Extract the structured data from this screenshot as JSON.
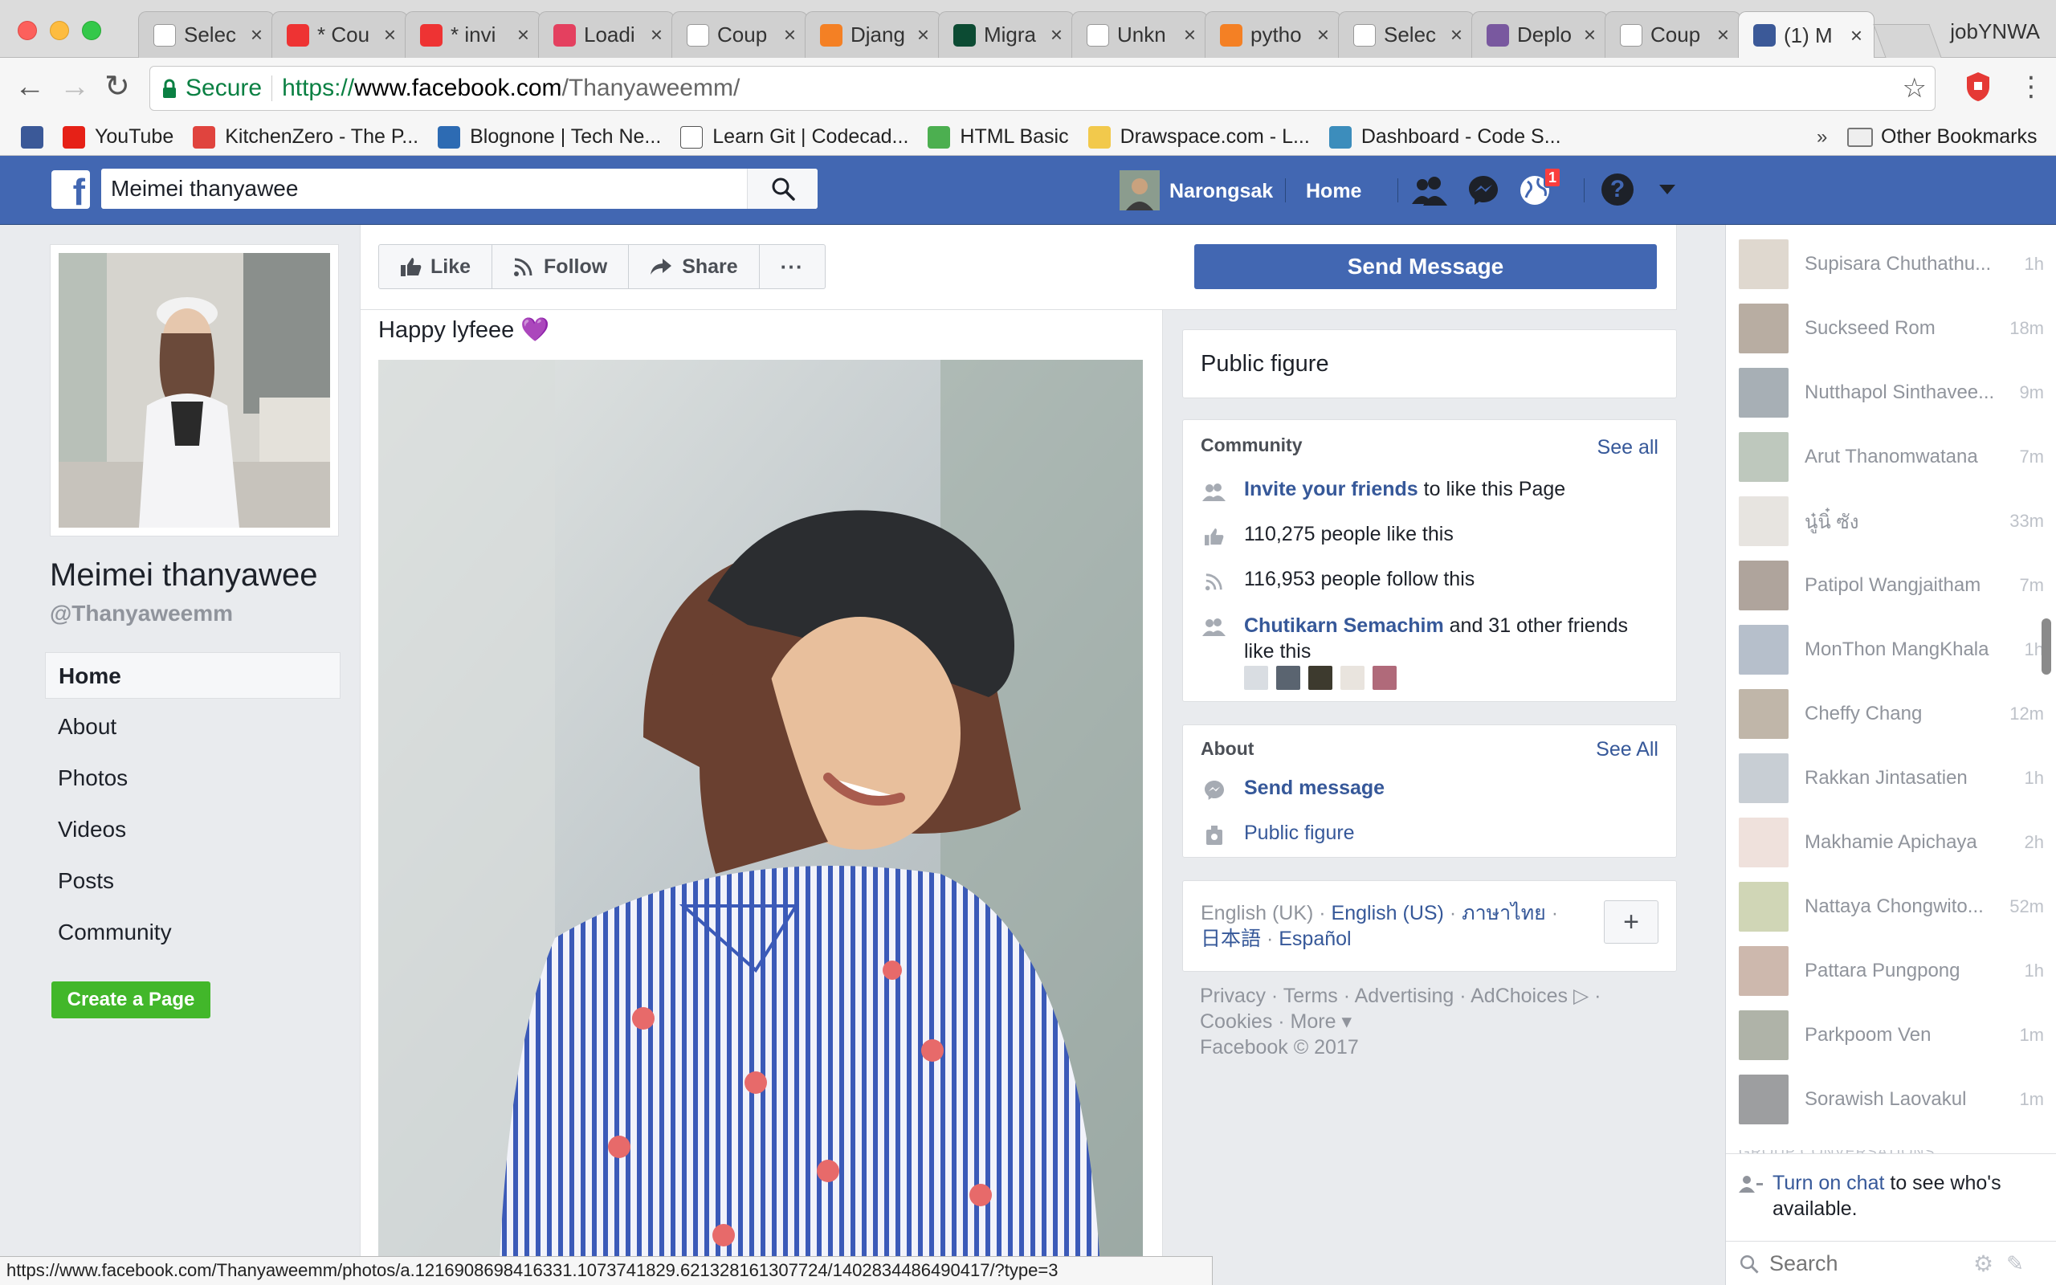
{
  "browser": {
    "profile": "jobYNWA",
    "tabs": [
      {
        "title": "Selec",
        "icon": "laravel",
        "color": "#fff"
      },
      {
        "title": "* Cou",
        "icon": "app-red",
        "color": "#e33"
      },
      {
        "title": "* invi",
        "icon": "app-red",
        "color": "#e33"
      },
      {
        "title": "Loadi",
        "icon": "invision",
        "color": "#e4405f"
      },
      {
        "title": "Coup",
        "icon": "laravel",
        "color": "#fff"
      },
      {
        "title": "Djang",
        "icon": "stackoverflow",
        "color": "#f48024"
      },
      {
        "title": "Migra",
        "icon": "django",
        "color": "#0c4b33"
      },
      {
        "title": "Unkn",
        "icon": "google",
        "color": "#fff"
      },
      {
        "title": "pytho",
        "icon": "stackoverflow",
        "color": "#f48024"
      },
      {
        "title": "Selec",
        "icon": "document",
        "color": "#fff"
      },
      {
        "title": "Deplo",
        "icon": "heroku",
        "color": "#79589f"
      },
      {
        "title": "Coup",
        "icon": "github",
        "color": "#fff"
      },
      {
        "title": "(1) M",
        "icon": "facebook",
        "color": "#3b5998"
      }
    ],
    "secure_label": "Secure",
    "url_scheme": "https://",
    "url_host": "www.facebook.com",
    "url_path": "/Thanyaweemm/",
    "bookmarks": [
      {
        "label": "",
        "icon": "facebook",
        "color": "#3b5998"
      },
      {
        "label": "YouTube",
        "icon": "youtube",
        "color": "#e62117"
      },
      {
        "label": "KitchenZero - The P...",
        "icon": "k",
        "color": "#e0443e"
      },
      {
        "label": "Blognone | Tech Ne...",
        "icon": "bn",
        "color": "#2d6bb3"
      },
      {
        "label": "Learn Git | Codecad...",
        "icon": "codecademy",
        "color": "#fff"
      },
      {
        "label": "HTML Basic",
        "icon": "w3",
        "color": "#4caf50"
      },
      {
        "label": "Drawspace.com - L...",
        "icon": "pencil",
        "color": "#f2c94c"
      },
      {
        "label": "Dashboard - Code S...",
        "icon": "code",
        "color": "#3c8dbc"
      }
    ],
    "other_bookmarks": "Other Bookmarks",
    "status_url": "https://www.facebook.com/Thanyaweemm/photos/a.1216908698416331.1073741829.621328161307724/1402834486490417/?type=3"
  },
  "fb": {
    "search_value": "Meimei thanyawee",
    "user_name": "Narongsak",
    "home": "Home",
    "notif_count": "1"
  },
  "page": {
    "name": "Meimei thanyawee",
    "username": "@Thanyaweemm",
    "nav": [
      "Home",
      "About",
      "Photos",
      "Videos",
      "Posts",
      "Community"
    ],
    "create_page": "Create a Page",
    "actions": {
      "like": "Like",
      "follow": "Follow",
      "share": "Share",
      "more": "···"
    },
    "send_message": "Send Message",
    "post_text": "Happy lyfeee 💜"
  },
  "sidebar": {
    "category": "Public figure",
    "community": {
      "title": "Community",
      "see_all": "See all",
      "invite_link": "Invite your friends",
      "invite_rest": " to like this Page",
      "likes": "110,275 people like this",
      "follows": "116,953 people follow this",
      "friend_link": "Chutikarn Semachim",
      "friend_rest": " and 31 other friends like this"
    },
    "about": {
      "title": "About",
      "see_all": "See All",
      "send_message": "Send message",
      "public_figure": "Public figure"
    },
    "languages": {
      "current": "English (UK)",
      "sep": " · ",
      "en_us": "English (US)",
      "thai": "ภาษาไทย",
      "japanese": "日本語",
      "spanish": "Español",
      "add": "+"
    },
    "footer": {
      "line1": "Privacy · Terms · Advertising · AdChoices ▷ ·",
      "line2": "Cookies · More ▾",
      "line3": "Facebook © 2017"
    }
  },
  "chat": {
    "friends": [
      {
        "name": "Supisara Chuthathu...",
        "time": "1h"
      },
      {
        "name": "Suckseed Rom",
        "time": "18m"
      },
      {
        "name": "Nutthapol Sinthavee...",
        "time": "9m"
      },
      {
        "name": "Arut Thanomwatana",
        "time": "7m"
      },
      {
        "name": "นู๋นิ๋ ซัง",
        "time": "33m"
      },
      {
        "name": "Patipol Wangjaitham",
        "time": "7m"
      },
      {
        "name": "MonThon MangKhala",
        "time": "1h"
      },
      {
        "name": "Cheffy Chang",
        "time": "12m"
      },
      {
        "name": "Rakkan Jintasatien",
        "time": "1h"
      },
      {
        "name": "Makhamie Apichaya",
        "time": "2h"
      },
      {
        "name": "Nattaya Chongwito...",
        "time": "52m"
      },
      {
        "name": "Pattara Pungpong",
        "time": "1h"
      },
      {
        "name": "Parkpoom Ven",
        "time": "1m"
      },
      {
        "name": "Sorawish Laovakul",
        "time": "1m"
      }
    ],
    "group_heading": "GROUP CONVERSATIONS",
    "turn_on": "Turn on chat",
    "turn_on_rest": " to see who's available.",
    "search_placeholder": "Search"
  },
  "colors": {
    "fb_blue": "#4267b2",
    "link": "#365899",
    "green": "#42b72a"
  }
}
